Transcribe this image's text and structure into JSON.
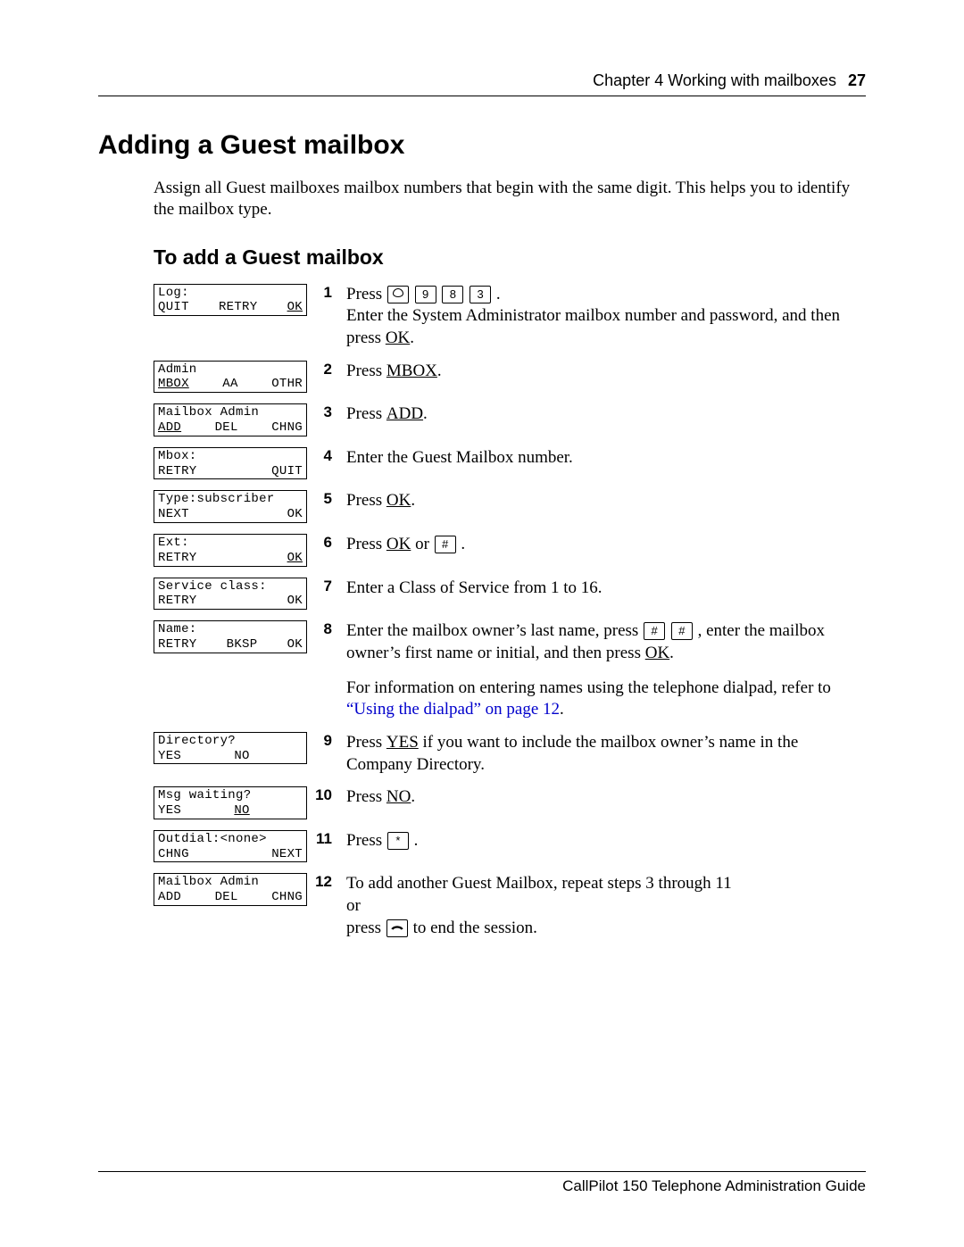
{
  "header": {
    "chapter": "Chapter 4  Working with mailboxes",
    "page": "27"
  },
  "title": "Adding a Guest mailbox",
  "intro": "Assign all Guest mailboxes mailbox numbers that begin with the same digit. This helps you to identify the mailbox type.",
  "subtitle": "To add a Guest mailbox",
  "lcd": {
    "s1": {
      "l1": "Log:",
      "k1": "QUIT",
      "k2": "RETRY",
      "k3": "OK",
      "ul": "k3"
    },
    "s2": {
      "l1": "Admin",
      "k1": "MBOX",
      "k2": "AA",
      "k3": "OTHR",
      "ul": "k1"
    },
    "s3": {
      "l1": "Mailbox Admin",
      "k1": "ADD",
      "k2": "DEL",
      "k3": "CHNG",
      "ul": "k1"
    },
    "s4": {
      "l1": "Mbox:",
      "k1": "RETRY",
      "k2": "",
      "k3": "QUIT",
      "ul": ""
    },
    "s5": {
      "l1": "Type:subscriber",
      "k1": "NEXT",
      "k2": "",
      "k3": "OK",
      "ul": ""
    },
    "s6": {
      "l1": "Ext:",
      "k1": "RETRY",
      "k2": "",
      "k3": "OK",
      "ul": "k3"
    },
    "s7": {
      "l1": "Service class:",
      "k1": "RETRY",
      "k2": "",
      "k3": "OK",
      "ul": ""
    },
    "s8": {
      "l1": "Name:",
      "k1": "RETRY",
      "k2": "BKSP",
      "k3": "OK",
      "ul": ""
    },
    "s9": {
      "l1": "Directory?",
      "k1": "YES",
      "k2": "NO",
      "k3": "",
      "ul": ""
    },
    "s10": {
      "l1": "Msg waiting?",
      "k1": "YES",
      "k2": "NO",
      "k3": "",
      "ul": "k2"
    },
    "s11": {
      "l1": "Outdial:<none>",
      "k1": "CHNG",
      "k2": "",
      "k3": "NEXT",
      "ul": ""
    },
    "s12": {
      "l1": "Mailbox Admin",
      "k1": "ADD",
      "k2": "DEL",
      "k3": "CHNG",
      "ul": ""
    }
  },
  "steps": {
    "s1": {
      "n": "1",
      "pre": "Press ",
      "keys": [
        "feature",
        "9",
        "8",
        "3"
      ],
      "post": " .",
      "rest": "Enter the System Administrator mailbox number and password, and then press ",
      "sk": "OK",
      "tail": "."
    },
    "s2": {
      "n": "2",
      "pre": "Press ",
      "sk": "MBOX",
      "post": "."
    },
    "s3": {
      "n": "3",
      "pre": "Press ",
      "sk": "ADD",
      "post": "."
    },
    "s4": {
      "n": "4",
      "text": "Enter the Guest Mailbox number."
    },
    "s5": {
      "n": "5",
      "pre": "Press ",
      "sk": "OK",
      "post": "."
    },
    "s6": {
      "n": "6",
      "pre": "Press ",
      "sk": "OK",
      "mid": " or ",
      "keys": [
        "#"
      ],
      "post": " ."
    },
    "s7": {
      "n": "7",
      "text": " Enter a Class of Service from 1 to 16."
    },
    "s8": {
      "n": "8",
      "pre": "Enter the mailbox owner’s last name, press ",
      "keys": [
        "#",
        "#"
      ],
      "mid": " , enter the mailbox owner’s first name or initial, and then press ",
      "sk": "OK",
      "post": ".",
      "extra_pre": "For information on entering names using the telephone dialpad, refer to ",
      "link": "“Using the dialpad” on page 12",
      "extra_post": "."
    },
    "s9": {
      "n": "9",
      "pre": "Press ",
      "sk": "YES",
      "post": " if you want to include the mailbox owner’s name in the Company Directory."
    },
    "s10": {
      "n": "10",
      "pre": "Press ",
      "sk": "NO",
      "post": "."
    },
    "s11": {
      "n": "11",
      "pre": "Press ",
      "keys": [
        "*"
      ],
      "post": " ."
    },
    "s12": {
      "n": "12",
      "a": "To add another Guest Mailbox, repeat steps 3 through 11",
      "b": "or",
      "c_pre": "press ",
      "c_post": " to end the session."
    }
  },
  "footer": "CallPilot 150 Telephone Administration Guide"
}
